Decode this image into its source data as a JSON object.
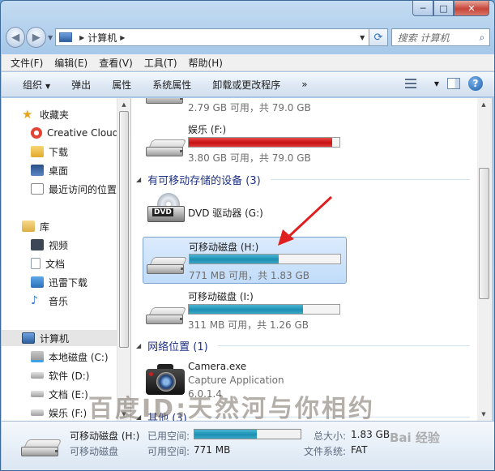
{
  "window": {
    "caption_min": "─",
    "caption_max": "□",
    "caption_close": "✕"
  },
  "nav": {
    "back_glyph": "◀",
    "forward_glyph": "▶",
    "address_path": "计算机",
    "search_placeholder": "搜索 计算机"
  },
  "menu": [
    "文件(F)",
    "编辑(E)",
    "查看(V)",
    "工具(T)",
    "帮助(H)"
  ],
  "toolbar": {
    "organize": "组织",
    "eject": "弹出",
    "properties": "属性",
    "system_properties": "系统属性",
    "uninstall": "卸载或更改程序",
    "more": "»"
  },
  "sidebar": {
    "favorites_header": "收藏夹",
    "favorites": [
      "Creative Cloud",
      "下载",
      "桌面",
      "最近访问的位置"
    ],
    "library_header": "库",
    "libraries": [
      "视频",
      "文档",
      "迅雷下载",
      "音乐"
    ],
    "computer_header": "计算机",
    "drives": [
      "本地磁盘 (C:)",
      "软件 (D:)",
      "文档 (E:)",
      "娱乐 (F:)"
    ]
  },
  "content": {
    "partial_drive": {
      "info": "2.79 GB 可用，共 79.0 GB",
      "used_fraction": 0.965
    },
    "drive_f": {
      "name": "娱乐 (F:)",
      "info": "3.80 GB 可用，共 79.0 GB",
      "used_fraction": 0.952
    },
    "removable_group": "有可移动存储的设备 (3)",
    "dvd": {
      "name": "DVD 驱动器 (G:)",
      "badge": "DVD"
    },
    "drive_h": {
      "name": "可移动磁盘 (H:)",
      "info": "771 MB 可用，共 1.83 GB",
      "used_fraction": 0.59
    },
    "drive_i": {
      "name": "可移动磁盘 (I:)",
      "info": "311 MB 可用，共 1.26 GB",
      "used_fraction": 0.76
    },
    "network_group": "网络位置 (1)",
    "camera": {
      "name": "Camera.exe",
      "desc": "Capture Application",
      "version": "6.0.1.4"
    },
    "other_group": "其他 (3)"
  },
  "details": {
    "name": "可移动磁盘 (H:)",
    "type": "可移动磁盘",
    "used_label": "已用空间:",
    "free_label": "可用空间:",
    "free_value": "771 MB",
    "total_label": "总大小:",
    "total_value": "1.83 GB",
    "fs_label": "文件系统:",
    "fs_value": "FAT",
    "used_fraction": 0.59
  },
  "watermark": {
    "text": "百度ID:天然河与你相约",
    "logo": "Bai 经验"
  },
  "colors": {
    "red_bar": "#c71212",
    "teal_bar": "#1c8fb2",
    "group_header": "#1e3287",
    "annotation_arrow": "#e02020"
  }
}
